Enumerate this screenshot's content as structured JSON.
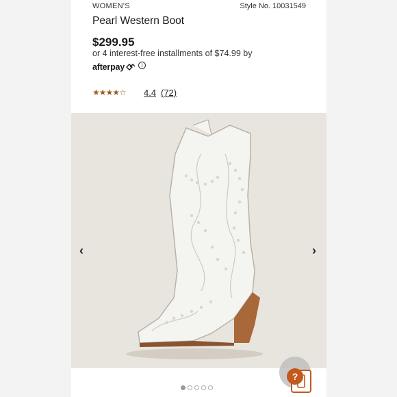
{
  "product": {
    "category": "WOMEN'S",
    "style_number": "Style No. 10031549",
    "title": "Pearl Western Boot",
    "price": "$299.95",
    "installments": "or 4 interest-free installments of $74.99 by",
    "afterpay_label": "afterpay",
    "rating_stars": "★★★★☆",
    "rating_value": "4.4",
    "review_count": "(72)"
  },
  "gallery": {
    "prev_glyph": "‹",
    "next_glyph": "›",
    "image_count": 5,
    "active_index": 0
  },
  "help": {
    "glyph": "?"
  },
  "colors": {
    "star": "#9a5b1e",
    "accent": "#c15a1a",
    "gallery_bg": "#e8e4de"
  }
}
